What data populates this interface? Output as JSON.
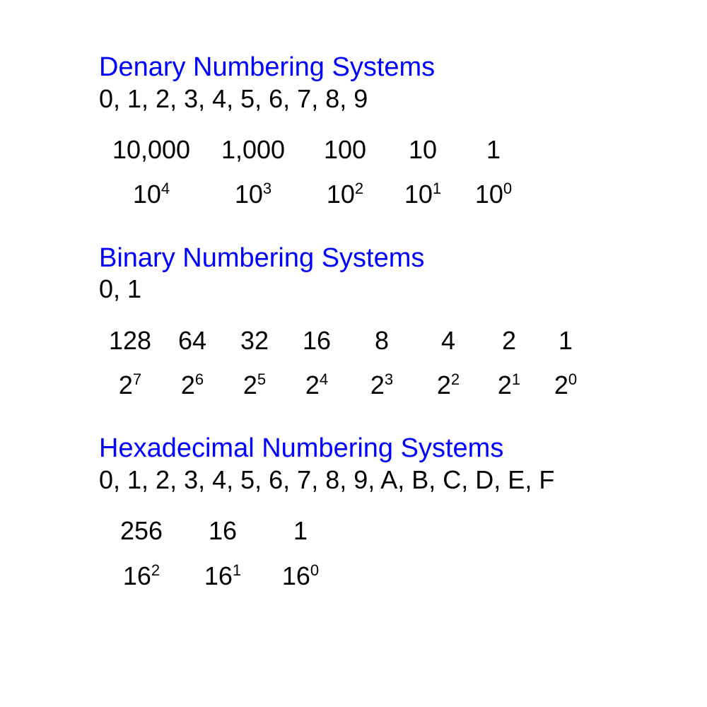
{
  "denary": {
    "title": "Denary Numbering Systems",
    "digits": "0, 1, 2, 3, 4, 5, 6, 7, 8, 9",
    "values": [
      "10,000",
      "1,000",
      "100",
      "10",
      "1"
    ],
    "power_base": "10",
    "power_exps": [
      "4",
      "3",
      "2",
      "1",
      "0"
    ]
  },
  "binary": {
    "title": "Binary Numbering Systems",
    "digits": "0, 1",
    "values": [
      "128",
      "64",
      "32",
      "16",
      "8",
      "4",
      "2",
      "1"
    ],
    "power_base": "2",
    "power_exps": [
      "7",
      "6",
      "5",
      "4",
      "3",
      "2",
      "1",
      "0"
    ]
  },
  "hex": {
    "title": "Hexadecimal Numbering Systems",
    "digits": "0, 1, 2, 3, 4, 5, 6, 7, 8, 9, A, B, C, D, E, F",
    "values": [
      "256",
      "16",
      "1"
    ],
    "power_base": "16",
    "power_exps": [
      "2",
      "1",
      "0"
    ]
  }
}
